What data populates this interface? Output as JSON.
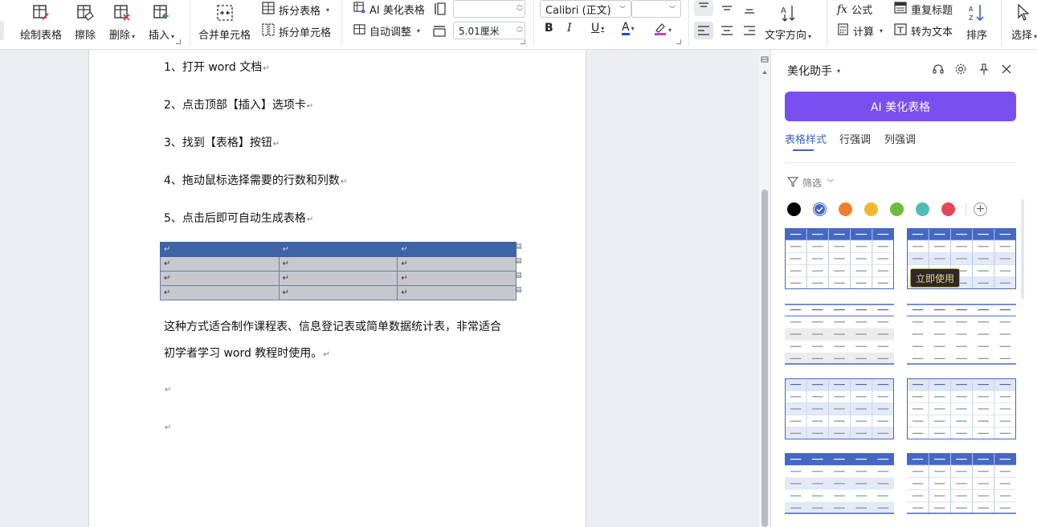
{
  "ribbon": {
    "draw_table": "绘制表格",
    "erase": "擦除",
    "delete": "删除",
    "insert": "插入",
    "merge_cells": "合并单元格",
    "split_table": "拆分表格",
    "split_cells": "拆分单元格",
    "ai_beautify": "AI 美化表格",
    "auto_fit": "自动调整",
    "row_height_value": "",
    "column_width_value": "5.01厘米",
    "font_name": "Calibri (正文)",
    "font_size": "",
    "bold": "B",
    "italic": "I",
    "underline": "U",
    "font_color_letter": "A",
    "text_direction": "文字方向",
    "formula": "公式",
    "calculate": "计算",
    "repeat_header": "重复标题",
    "convert_to_text": "转为文本",
    "sort": "排序",
    "select": "选择"
  },
  "document": {
    "steps": [
      "1、打开 word 文档",
      "2、点击顶部【插入】选项卡",
      "3、找到【表格】按钮",
      "4、拖动鼠标选择需要的行数和列数",
      "5、点击后即可自动生成表格"
    ],
    "para_line1": "这种方式适合制作课程表、信息登记表或简单数据统计表，非常适合",
    "para_line2": "初学者学习 word 教程时使用。",
    "paragraph_mark": "↵"
  },
  "panel": {
    "title": "美化助手",
    "ai_button": "AI 美化表格",
    "tabs": [
      "表格样式",
      "行强调",
      "列强调"
    ],
    "active_tab": 0,
    "filter": "筛选",
    "swatches": [
      "#000000",
      "#4468c4",
      "#ef7f2d",
      "#f2b632",
      "#6ebc3c",
      "#4dbdb5",
      "#e3485a"
    ],
    "selected_swatch": 1,
    "tooltip": "立即使用"
  },
  "colors": {
    "accent_purple": "#7a4ff0",
    "table_header_blue": "#3e63a6",
    "active_tab_blue": "#3b62c7"
  }
}
